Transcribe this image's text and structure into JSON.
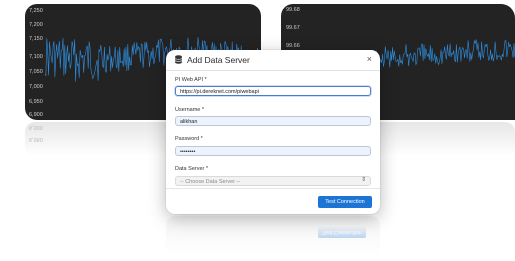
{
  "charts": {
    "left": {
      "y_ticks": [
        "7,250",
        "7,200",
        "7,150",
        "7,100",
        "7,050",
        "7,000",
        "6,950",
        "6,900"
      ]
    },
    "right": {
      "y_ticks": [
        "99.68",
        "99.67",
        "99.66"
      ]
    }
  },
  "dialog": {
    "title": "Add Data Server",
    "close_label": "×",
    "piwebapi_label": "PI Web API *",
    "piwebapi_value": "https://pi.dereknet.com/piwebapi",
    "username_label": "Username *",
    "username_value": "alikhan",
    "password_label": "Password *",
    "password_value": "••••••••",
    "dataserver_label": "Data Server *",
    "dataserver_placeholder": "-- Choose Data Server --",
    "test_button": "Test Connection"
  },
  "colors": {
    "panel_bg": "#232323",
    "series_line": "#2f8fe0",
    "primary": "#1c74d4"
  }
}
